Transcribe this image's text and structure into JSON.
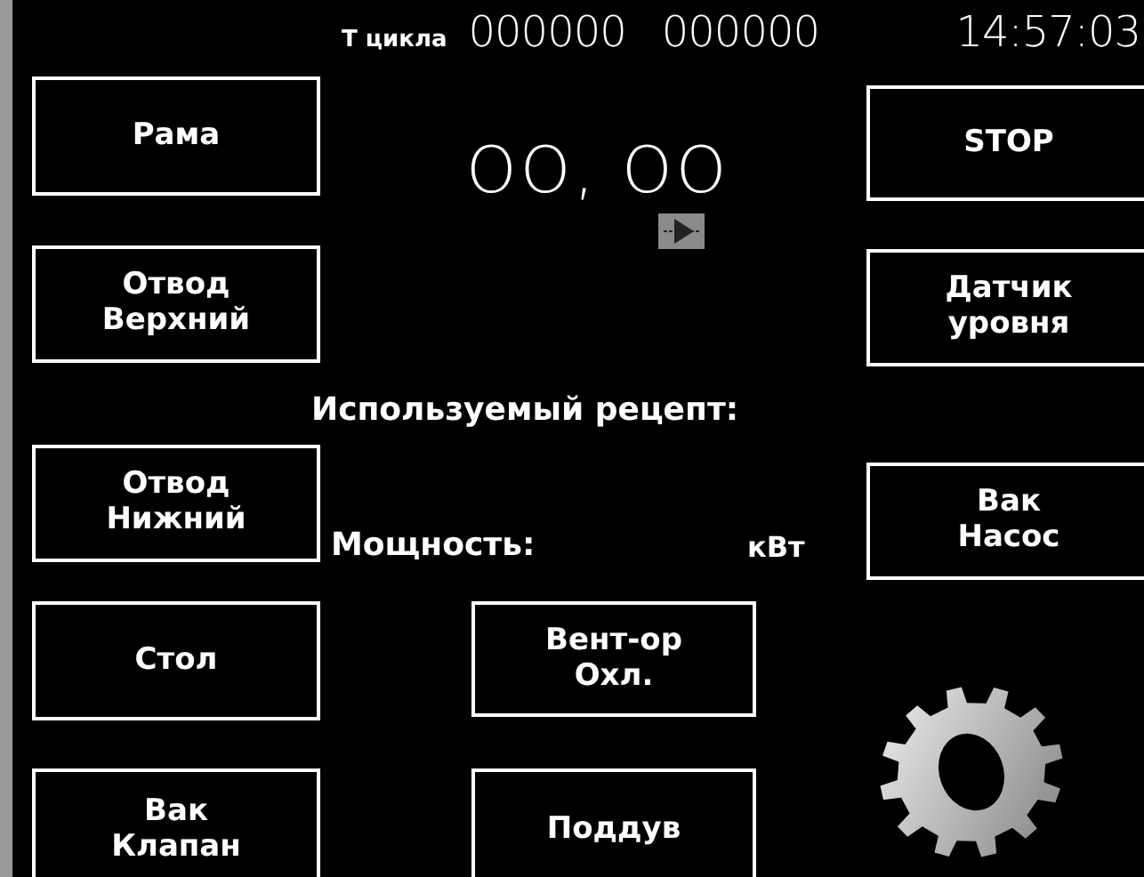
{
  "header": {
    "cycle_label": "Т цикла",
    "counter_1": "000000",
    "counter_2": "000000",
    "time": "14:57:03"
  },
  "display_value": "OO, OO",
  "recipe_label": "Используемый рецепт:",
  "power": {
    "label": "Мощность:",
    "unit": "кВт"
  },
  "left_buttons": [
    "Рама",
    "Отвод\nВерхний",
    "Отвод\nНижний",
    "Стол",
    "Вак\nКлапан"
  ],
  "right_buttons": [
    "STOP",
    "Датчик\nуровня",
    "Вак\nНасос"
  ],
  "center_buttons": [
    "Вент-ор\nОхл.",
    "Поддув"
  ]
}
